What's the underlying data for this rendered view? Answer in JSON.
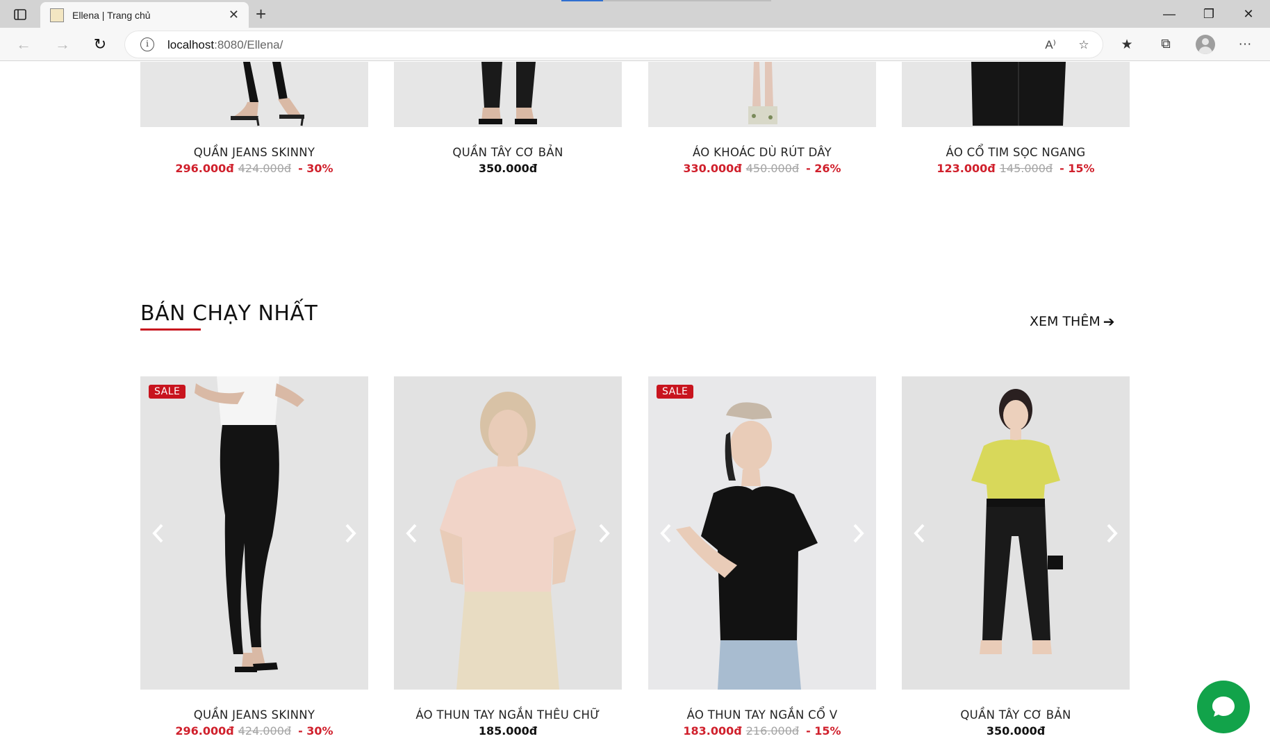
{
  "browser": {
    "tab_title": "Ellena | Trang chủ",
    "tab_close": "✕",
    "new_tab": "+",
    "url_host": "localhost",
    "url_path": ":8080/Ellena/",
    "window_minimize": "—",
    "window_restore": "❐",
    "window_close": "✕",
    "read_aloud": "A⁾",
    "more_menu": "···"
  },
  "top_row": {
    "products": [
      {
        "name": "QUẦN JEANS SKINNY",
        "sale_price": "296.000đ",
        "old_price": "424.000đ",
        "discount": "- 30%"
      },
      {
        "name": "QUẦN TÂY CƠ BẢN",
        "price": "350.000đ"
      },
      {
        "name": "ÁO KHOÁC DÙ RÚT DÂY",
        "sale_price": "330.000đ",
        "old_price": "450.000đ",
        "discount": "- 26%"
      },
      {
        "name": "ÁO CỔ TIM SỌC NGANG",
        "sale_price": "123.000đ",
        "old_price": "145.000đ",
        "discount": "- 15%"
      }
    ]
  },
  "best_sellers": {
    "title": "BÁN CHẠY NHẤT",
    "see_more": "XEM THÊM",
    "sale_badge": "SALE",
    "products": [
      {
        "name": "QUẦN JEANS SKINNY",
        "sale_price": "296.000đ",
        "old_price": "424.000đ",
        "discount": "- 30%"
      },
      {
        "name": "ÁO THUN TAY NGẮN THÊU CHỮ",
        "price": "185.000đ"
      },
      {
        "name": "ÁO THUN TAY NGẮN CỔ V",
        "sale_price": "183.000đ",
        "old_price": "216.000đ",
        "discount": "- 15%"
      },
      {
        "name": "QUẦN TÂY CƠ BẢN",
        "price": "350.000đ"
      }
    ]
  },
  "colors": {
    "accent_red": "#c8141e",
    "price_red": "#d0202c",
    "chat_green": "#12a34a"
  }
}
